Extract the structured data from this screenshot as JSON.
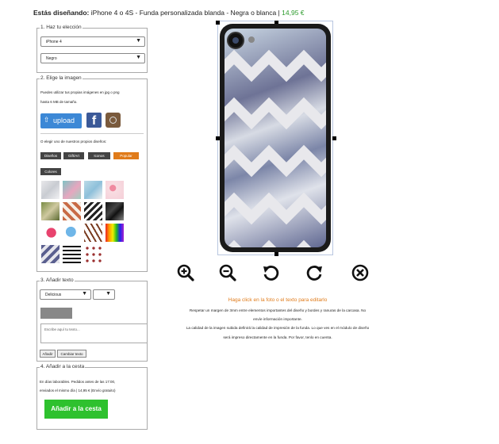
{
  "header": {
    "label": "Estás diseñando:",
    "product": "iPhone 4 o 4S - Funda personalizada blanda - Negra o blanca |",
    "price": "14,95 €"
  },
  "step1": {
    "legend": "1. Haz tu elección",
    "model_value": "iPhone 4",
    "color_value": "Negro"
  },
  "step2": {
    "legend": "2. Elige la imagen",
    "upload_hint_1": "Puedes utilizar tus propias imágenes en jpg o png",
    "upload_hint_2": "hasta 6 MB de tamaño.",
    "upload_label": "upload",
    "facebook_letter": "f",
    "choose_text": "O elegir uno de nuestros propios diseños:",
    "categories": [
      "Diseños",
      "Gift/Art",
      "Iconos",
      "Popular",
      "Colores"
    ],
    "active_category": "Popular"
  },
  "step3": {
    "legend": "3. Añadir texto",
    "font_value": "Delicious",
    "size_value": "",
    "text_placeholder": "Escribe aquí tu texto...",
    "add_label": "Añadir",
    "change_label": "Cambiar texto"
  },
  "step4": {
    "legend": "4. Añadir a la cesta",
    "info_1": "En días laborables. Pedidos antes de las 17:00,",
    "info_2": "enviados el mismo día | 14,95 € (Envío gratuito)",
    "cart_label": "Añadir a la cesta"
  },
  "editor": {
    "hint": "Haga click en la foto o el texto para editarlo",
    "note_1": "Respetar un margen de 3mm entre elementos importantes del diseño y bordes y ranuras de la carcasa. No",
    "note_2": "envíe información importante.",
    "note_3": "La calidad de la imagen subida definirá la calidad de impresión de la funda. Lo que ves en el módulo de diseño",
    "note_4": "será impreso directamente en la funda. Por favor, tenlo en cuenta."
  },
  "colors": {
    "price": "#2a9a2a",
    "upload": "#3c88d6",
    "facebook": "#3b5998",
    "active_category": "#e07b1a",
    "cart": "#2ec12e",
    "hint": "#e07b1a"
  }
}
